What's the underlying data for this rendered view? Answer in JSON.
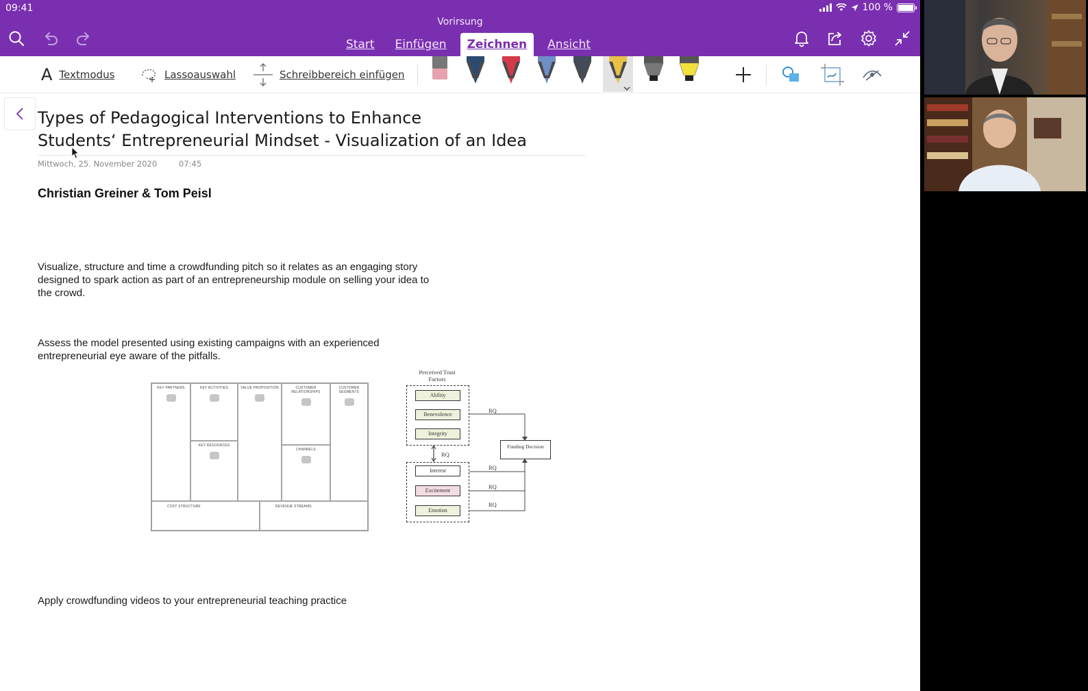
{
  "status": {
    "time": "09:41",
    "battery": "100 %"
  },
  "app": {
    "document_title": "Vorirsung"
  },
  "ribbon": {
    "tabs": [
      {
        "label": "Start"
      },
      {
        "label": "Einfügen"
      },
      {
        "label": "Zeichnen"
      },
      {
        "label": "Ansicht"
      }
    ],
    "active_tab": "Zeichnen"
  },
  "toolbar": {
    "text_mode": "Textmodus",
    "lasso": "Lassoauswahl",
    "insert_space": "Schreibbereich einfügen"
  },
  "pens": [
    {
      "color": "#e6a2ad",
      "kind": "eraser"
    },
    {
      "color": "#2b4a6e",
      "kind": "pen"
    },
    {
      "color": "#d33a4a",
      "kind": "pen"
    },
    {
      "color": "#6f8ec7",
      "kind": "pen"
    },
    {
      "color": "#434a5a",
      "kind": "pen"
    },
    {
      "color": "#e9c04a",
      "kind": "pencil",
      "selected": true
    },
    {
      "color": "#777777",
      "kind": "highlighter"
    },
    {
      "color": "#f3e13b",
      "kind": "highlighter"
    }
  ],
  "page": {
    "title_line1": "Types of Pedagogical Interventions to Enhance",
    "title_line2": "Students‘ Entrepreneurial Mindset - Visualization of an Idea",
    "date": "Mittwoch, 25. November 2020",
    "time": "07:45",
    "authors": "Christian Greiner & Tom Peisl",
    "para1_line1": "Visualize, structure and time a crowdfunding pitch so it relates as an engaging story",
    "para1_line2": "designed to spark action as part of an entrepreneurship module on selling your idea to",
    "para1_line3": "the crowd.",
    "para2_line1": "Assess the model presented using existing campaigns with an experienced",
    "para2_line2": "entrepreneurial eye aware of the pitfalls.",
    "para3": "Apply crowdfunding videos to your entrepreneurial teaching practice"
  },
  "canvas": {
    "key_partners": "KEY PARTNERS",
    "key_activities": "KEY ACTIVITIES",
    "key_resources": "KEY RESOURCES",
    "value_proposition": "VALUE PROPOSITION",
    "customer_relationships": "CUSTOMER RELATIONSHIPS",
    "channels": "CHANNELS",
    "customer_segments": "CUSTOMER SEGMENTS",
    "cost_structure": "COST STRUCTURE",
    "revenue_streams": "REVENUE STREAMS"
  },
  "trust_diagram": {
    "header": "Perceived Trust Factors",
    "trust_factors": [
      "Ability",
      "Benevolence",
      "Integrity"
    ],
    "emotion_factors": [
      "Interest",
      "Excitement",
      "Emotion"
    ],
    "outcome": "Funding Decision",
    "rq_labels": [
      "RQ",
      "RQ",
      "RQ",
      "RQ",
      "RQ"
    ]
  }
}
